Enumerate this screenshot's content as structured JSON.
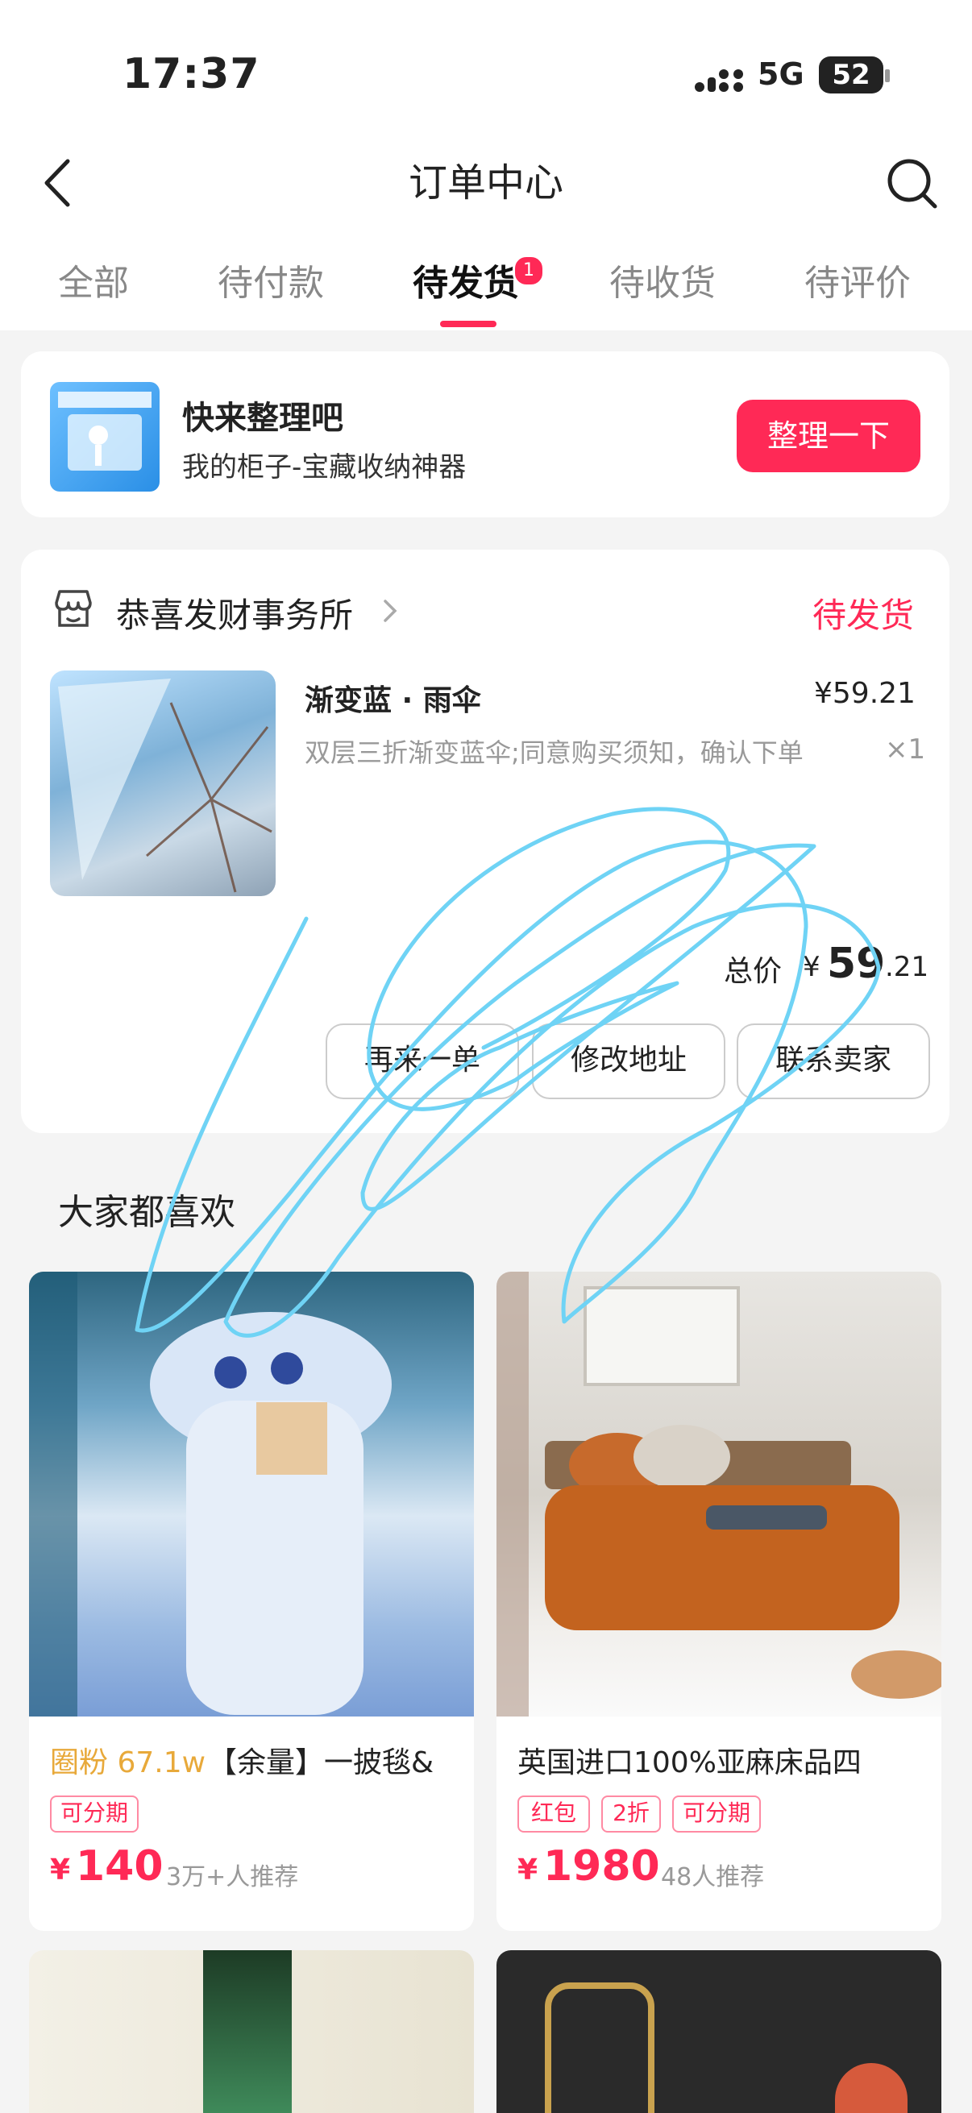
{
  "status": {
    "time": "17:37",
    "network": "5G",
    "battery": "52"
  },
  "header": {
    "title": "订单中心"
  },
  "tabs": [
    {
      "label": "全部"
    },
    {
      "label": "待付款"
    },
    {
      "label": "待发货",
      "badge": "1"
    },
    {
      "label": "待收货"
    },
    {
      "label": "待评价"
    }
  ],
  "promo": {
    "title": "快来整理吧",
    "subtitle": "我的柜子-宝藏收纳神器",
    "button": "整理一下"
  },
  "order": {
    "shop": "恭喜发财事务所",
    "status": "待发货",
    "item": {
      "name": "渐变蓝 · 雨伞",
      "price": "¥59.21",
      "desc": "双层三折渐变蓝伞;同意购买须知，确认下单",
      "qty": "×1"
    },
    "total_label": "总价",
    "total_symbol": "¥",
    "total_int": "59",
    "total_dec": ".21",
    "actions": [
      "再来一单",
      "修改地址",
      "联系卖家"
    ]
  },
  "recommend": {
    "title": "大家都喜欢",
    "items": [
      {
        "prefix": "圈粉 67.1w",
        "title": "【余量】一披毯&",
        "tags": [
          "可分期"
        ],
        "price_symbol": "¥",
        "price": "140",
        "reco": "3万+人推荐"
      },
      {
        "prefix": "",
        "title": "英国进口100%亚麻床品四",
        "tags": [
          "红包",
          "2折",
          "可分期"
        ],
        "price_symbol": "¥",
        "price": "1980",
        "reco": "48人推荐"
      }
    ]
  },
  "colors": {
    "accent": "#ff2956",
    "gold": "#e8a93a",
    "scribble": "#6fd3f5"
  }
}
